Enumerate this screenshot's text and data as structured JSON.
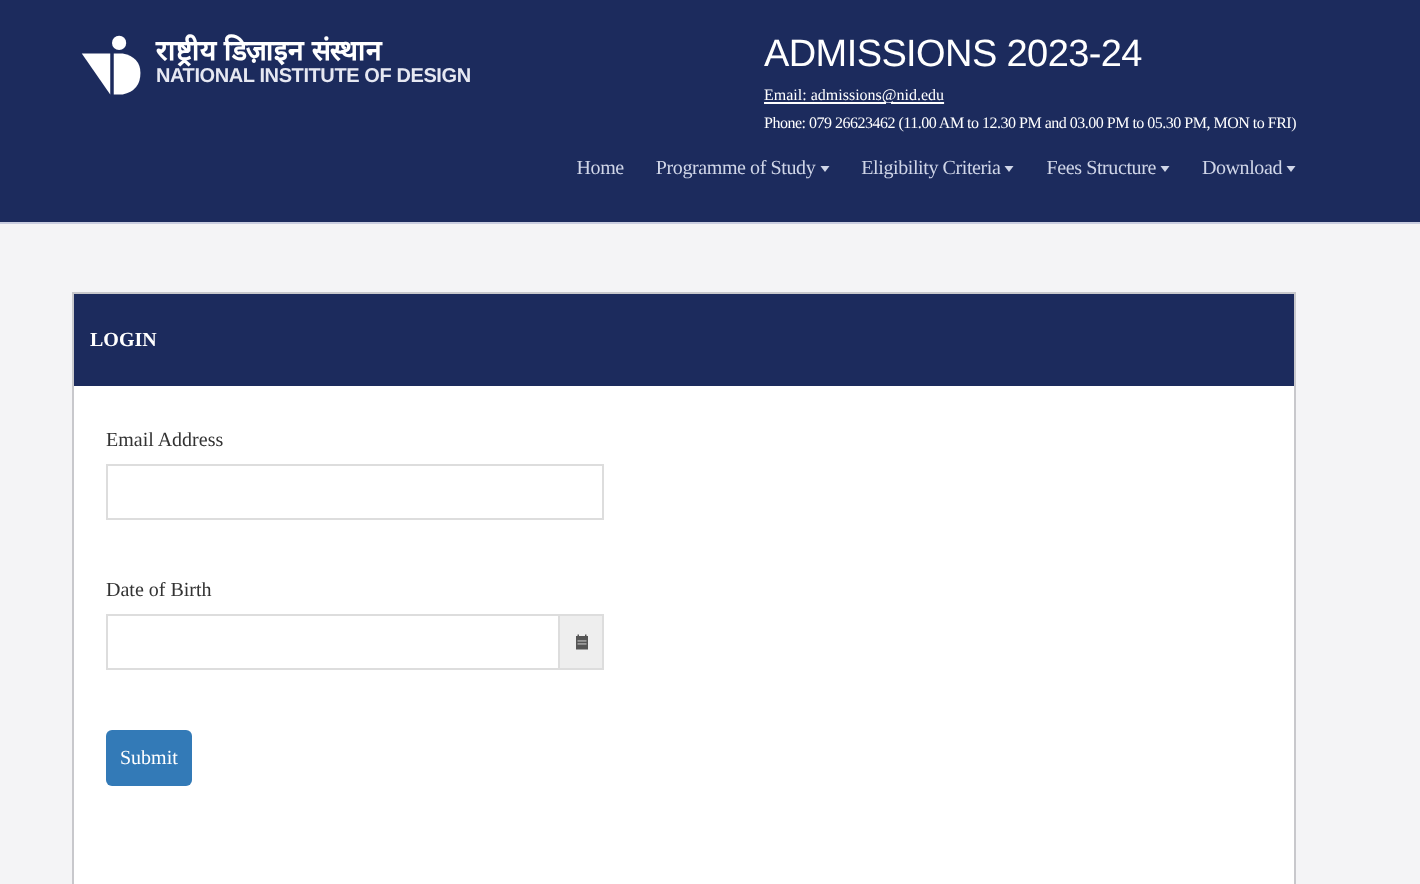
{
  "header": {
    "logo_hindi": "राष्ट्रीय डिज़ाइन संस्थान",
    "logo_english": "NATIONAL INSTITUTE OF DESIGN",
    "title": "ADMISSIONS 2023-24",
    "email": "Email: admissions@nid.edu",
    "phone": "Phone: 079 26623462 (11.00 AM to 12.30 PM and 03.00 PM to 05.30 PM, MON to FRI)"
  },
  "nav": [
    {
      "label": "Home",
      "dropdown": false
    },
    {
      "label": "Programme of Study",
      "dropdown": true
    },
    {
      "label": "Eligibility Criteria",
      "dropdown": true
    },
    {
      "label": "Fees Structure",
      "dropdown": true
    },
    {
      "label": "Download",
      "dropdown": true
    }
  ],
  "login": {
    "title": "LOGIN",
    "fields": [
      {
        "label": "Email Address",
        "kind": "text"
      },
      {
        "label": "Date of Birth",
        "kind": "date"
      }
    ],
    "submit": "Submit"
  }
}
